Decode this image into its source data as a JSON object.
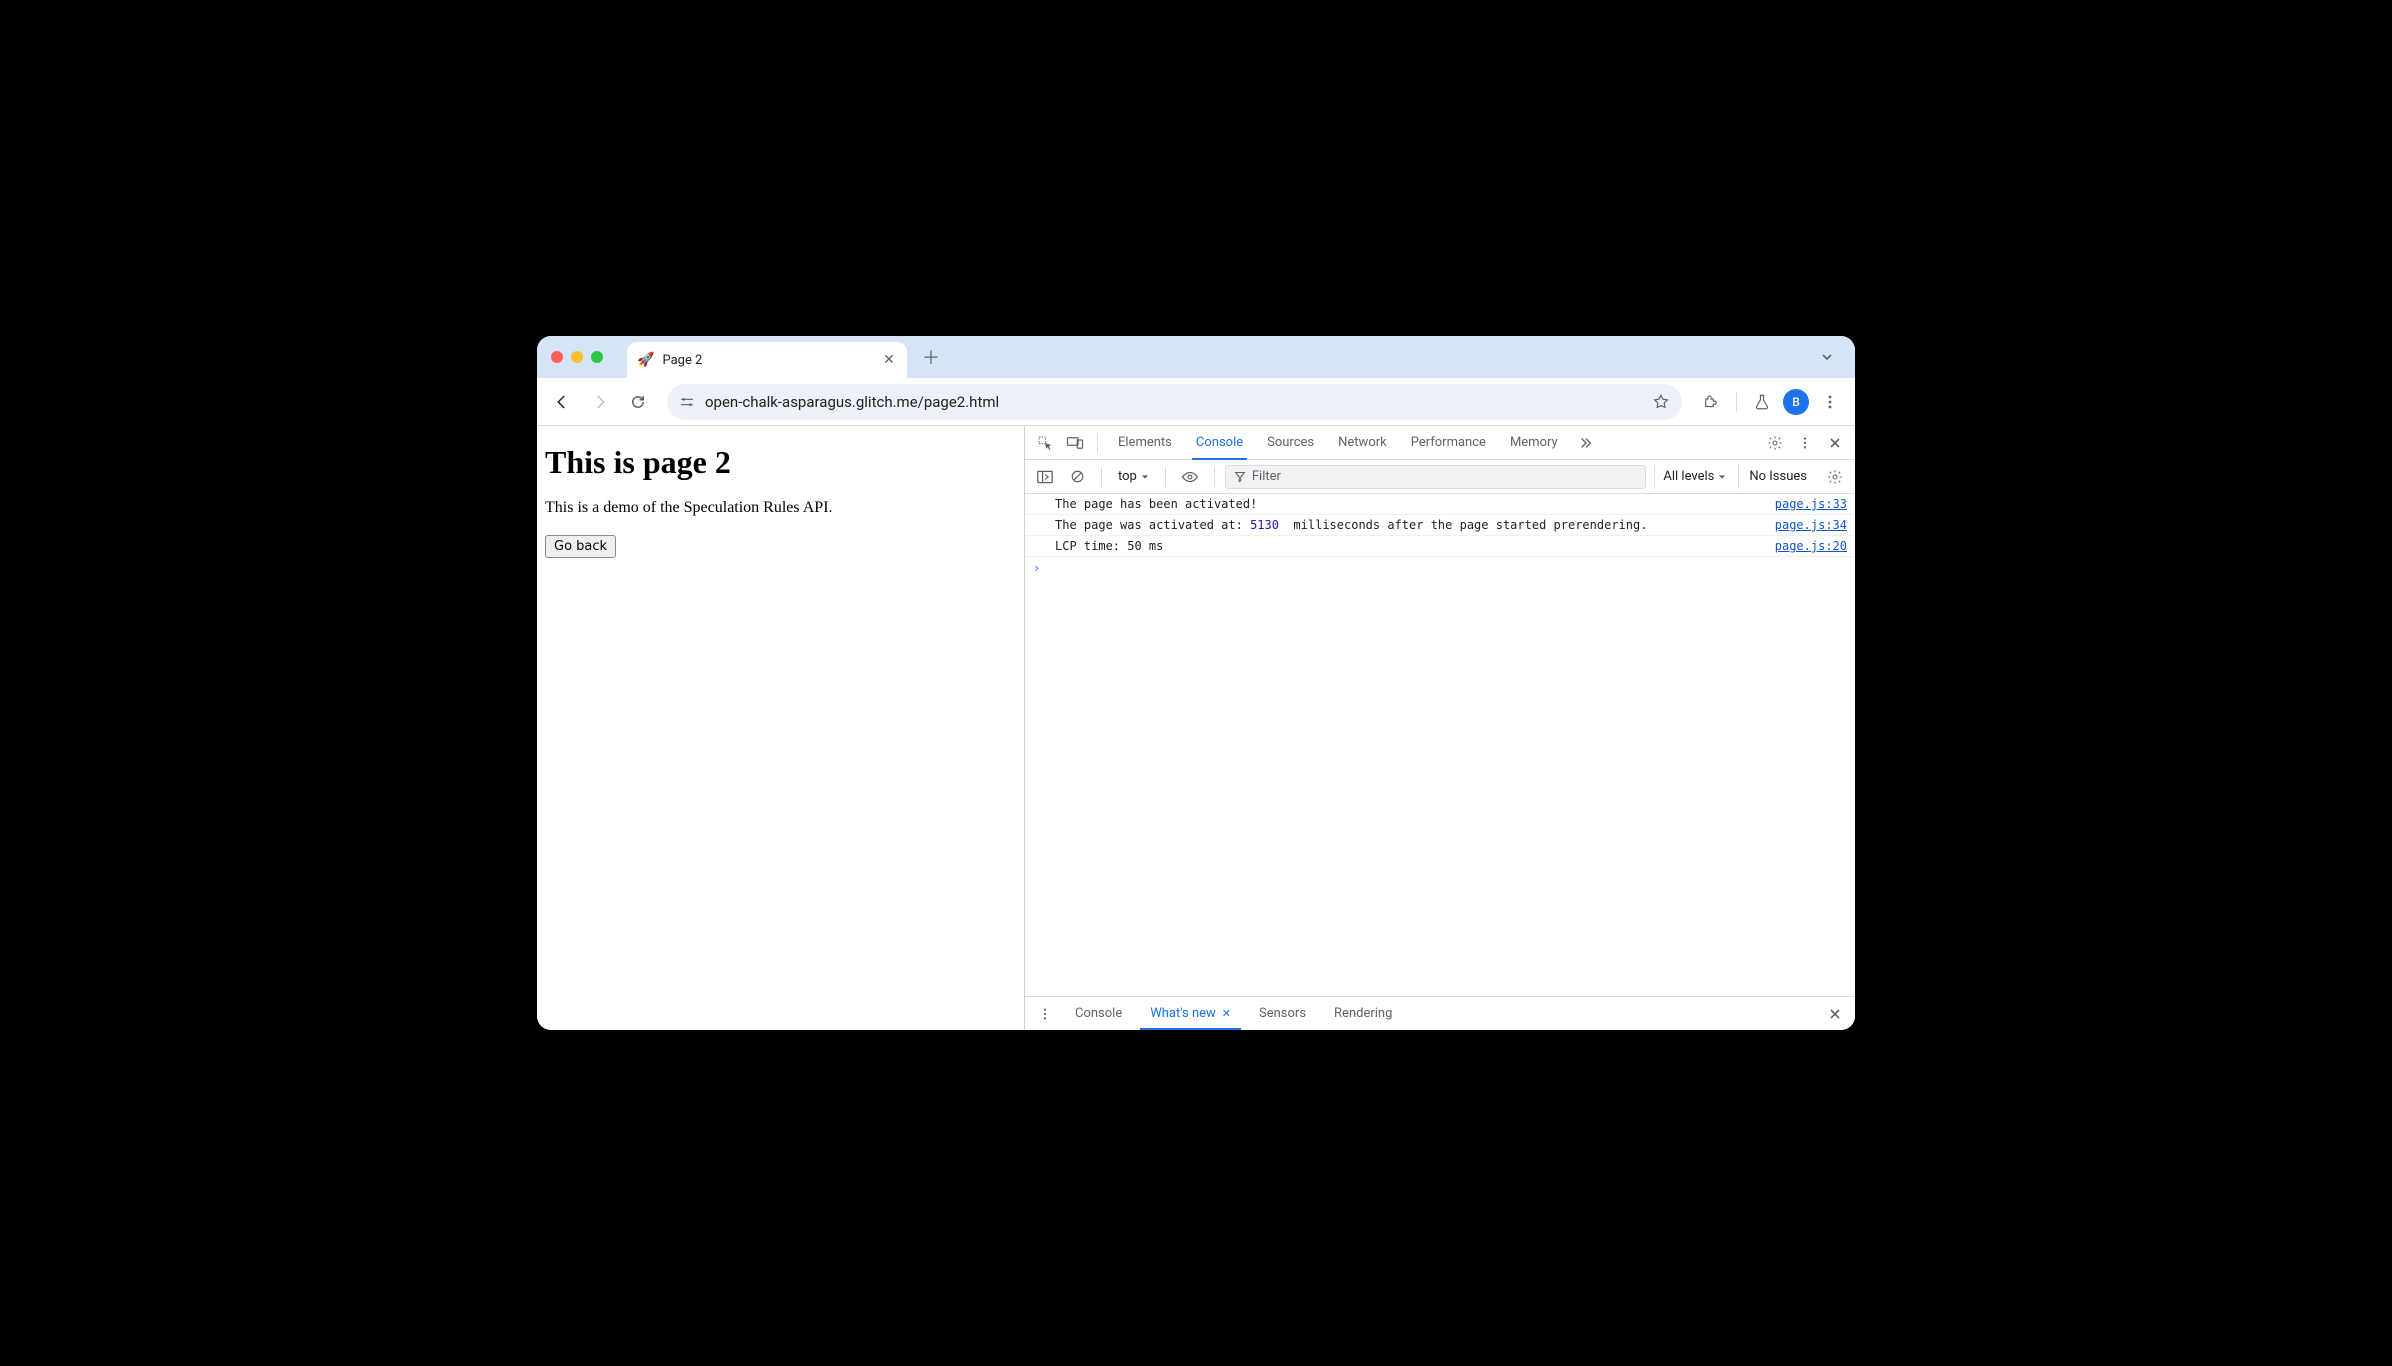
{
  "browser": {
    "tab": {
      "favicon": "🚀",
      "title": "Page 2"
    },
    "url": "open-chalk-asparagus.glitch.me/page2.html",
    "avatar_initial": "B"
  },
  "page": {
    "heading": "This is page 2",
    "paragraph": "This is a demo of the Speculation Rules API.",
    "button_label": "Go back"
  },
  "devtools": {
    "tabs": [
      "Elements",
      "Console",
      "Sources",
      "Network",
      "Performance",
      "Memory"
    ],
    "active_tab": "Console",
    "context": "top",
    "filter_placeholder": "Filter",
    "levels_label": "All levels",
    "issues_label": "No Issues",
    "logs": [
      {
        "parts": [
          {
            "t": "The page has been activated!"
          }
        ],
        "src": "page.js:33"
      },
      {
        "parts": [
          {
            "t": "The page was activated at: "
          },
          {
            "t": "5130",
            "cls": "num"
          },
          {
            "t": "  milliseconds after the page started prerendering."
          }
        ],
        "src": "page.js:34"
      },
      {
        "parts": [
          {
            "t": "LCP time: 50 ms"
          }
        ],
        "src": "page.js:20"
      }
    ],
    "drawer_tabs": [
      "Console",
      "What's new",
      "Sensors",
      "Rendering"
    ],
    "drawer_active": "What's new"
  }
}
